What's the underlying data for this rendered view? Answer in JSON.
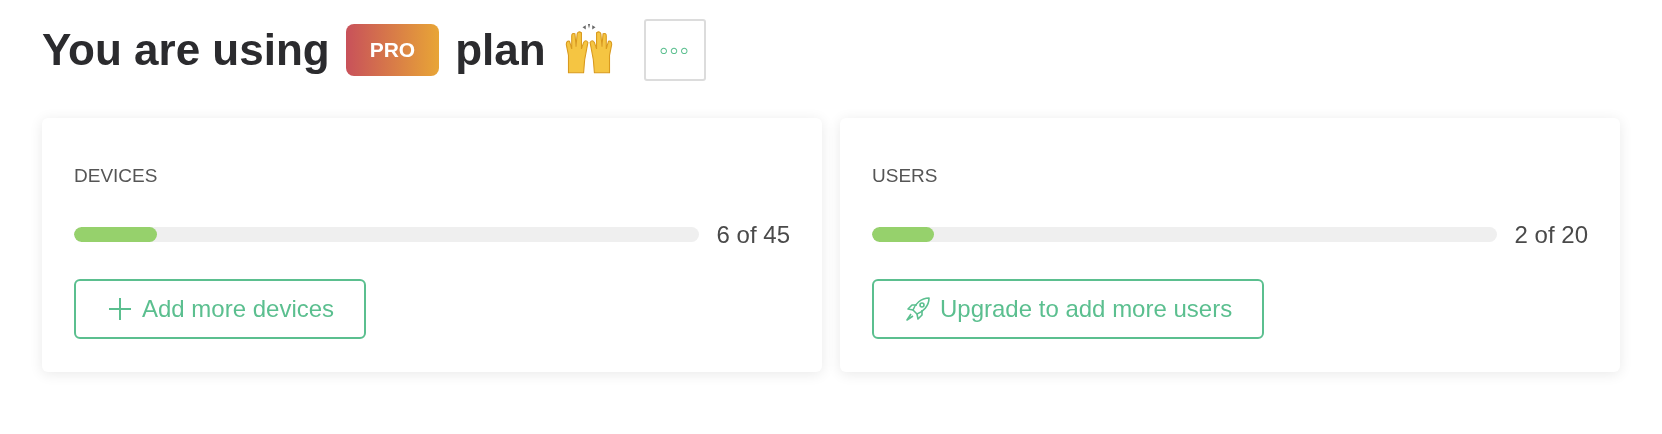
{
  "heading": {
    "before": "You are using",
    "badge": "PRO",
    "after": "plan",
    "more_button": "◦◦◦"
  },
  "cards": [
    {
      "title": "DEVICES",
      "level": 0.133,
      "reading": "6 of 45",
      "button": {
        "label": "Add more devices",
        "kind": "add"
      }
    },
    {
      "title": "USERS",
      "level": 0.1,
      "reading": "2 of 20",
      "button": {
        "label": "Upgrade to add more users",
        "kind": "upgrade"
      }
    }
  ]
}
